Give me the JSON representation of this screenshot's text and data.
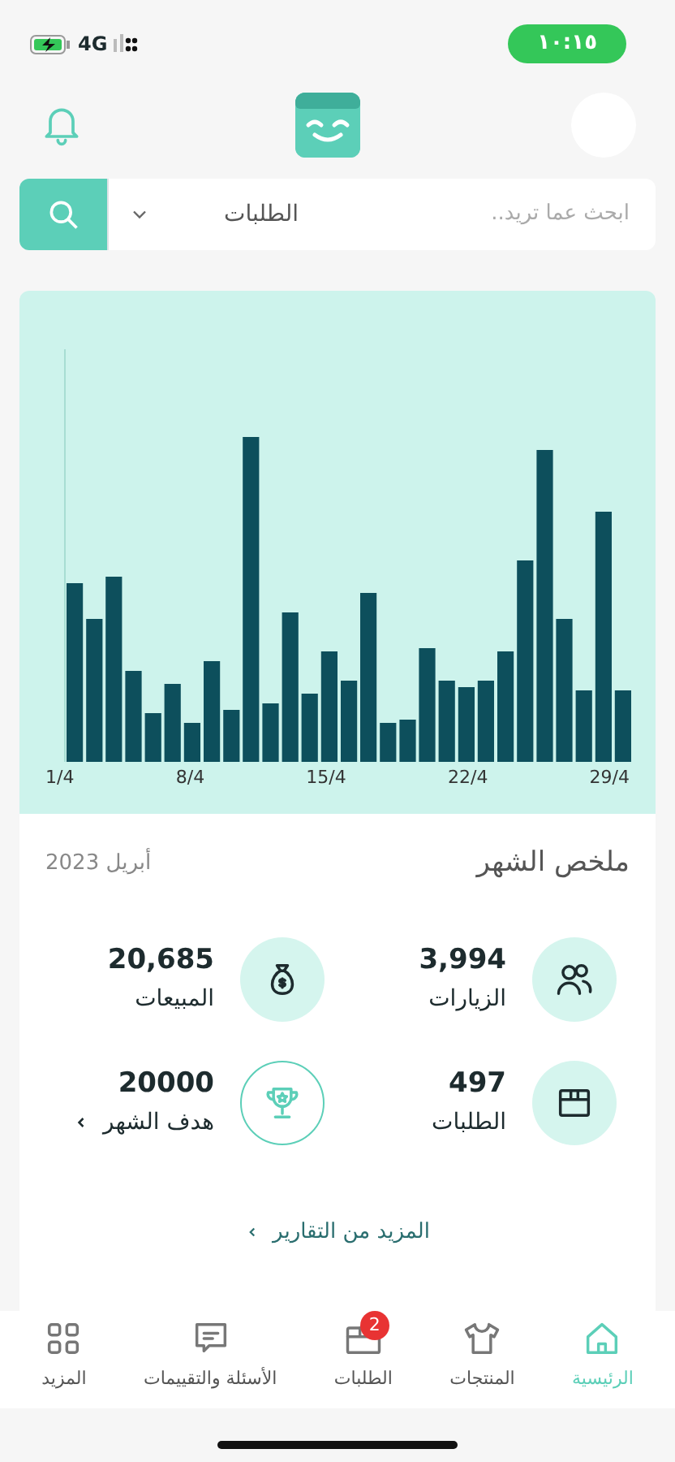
{
  "status_bar": {
    "time": "١٠:١٥",
    "network": "4G"
  },
  "search": {
    "placeholder": "ابحث عما تريد..",
    "category": "الطلبات"
  },
  "chart": {
    "x_labels": [
      "29/4",
      "22/4",
      "15/4",
      "8/4",
      "1/4"
    ]
  },
  "summary": {
    "title": "ملخص الشهر",
    "period": "أبريل 2023",
    "stats": [
      {
        "kind": "stat",
        "value": "3,994",
        "label": "الزيارات"
      },
      {
        "kind": "stat",
        "value": "20,685",
        "label": "المبيعات"
      },
      {
        "kind": "stat",
        "value": "497",
        "label": "الطلبات"
      },
      {
        "kind": "goal",
        "value": "20000",
        "label": "هدف الشهر"
      }
    ],
    "more_link": "المزيد من التقارير"
  },
  "tab_bar": [
    {
      "label": "الرئيسية",
      "selected": true
    },
    {
      "label": "المنتجات",
      "selected": false
    },
    {
      "label": "الطلبات",
      "selected": false,
      "badge": "2"
    },
    {
      "label": "الأسئلة والتقييمات",
      "selected": false
    },
    {
      "label": "المزيد",
      "selected": false
    }
  ]
}
